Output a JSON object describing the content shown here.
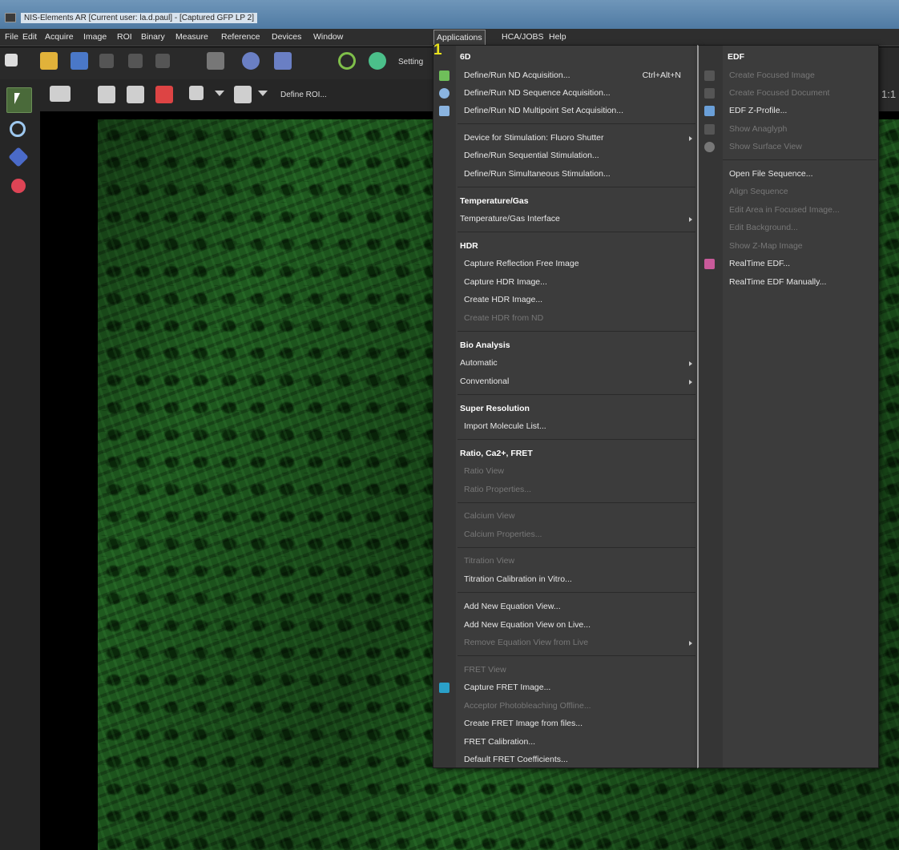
{
  "window": {
    "title": "NIS-Elements AR [Current user: la.d.paul] - [Captured GFP LP 2]"
  },
  "menubar": {
    "items": [
      "File",
      "Edit",
      "Acquire",
      "Image",
      "ROI",
      "Binary",
      "Measure",
      "Reference",
      "Devices",
      "Window",
      "Applications",
      "HCA/JOBS",
      "Help"
    ],
    "active": "Applications"
  },
  "toolbar": {
    "settings_label": "Setting",
    "define_roi_label": "Define ROI..."
  },
  "zoom_label": "1:1",
  "step_marker": "1",
  "applications_menu": {
    "sections": {
      "six_d": "6D",
      "temperature": "Temperature/Gas",
      "hdr": "HDR",
      "bio": "Bio Analysis",
      "super_res": "Super Resolution",
      "ratio": "Ratio, Ca2+, FRET"
    },
    "items": {
      "nd_acq": "Define/Run ND Acquisition...",
      "nd_acq_shortcut": "Ctrl+Alt+N",
      "nd_seq": "Define/Run ND Sequence Acquisition...",
      "nd_multi": "Define/Run ND Multipoint Set Acquisition...",
      "stim_device": "Device for Stimulation: Fluoro Shutter",
      "seq_stim": "Define/Run Sequential Stimulation...",
      "sim_stim": "Define/Run Simultaneous Stimulation...",
      "temp_iface": "Temperature/Gas Interface",
      "refl_free": "Capture Reflection Free Image",
      "cap_hdr": "Capture HDR Image...",
      "create_hdr": "Create HDR Image...",
      "hdr_from_nd": "Create HDR from ND",
      "automatic": "Automatic",
      "conventional": "Conventional",
      "import_mol": "Import Molecule List...",
      "ratio_view": "Ratio View",
      "ratio_props": "Ratio Properties...",
      "calcium_view": "Calcium View",
      "calcium_props": "Calcium Properties...",
      "titration_view": "Titration View",
      "titration_cal": "Titration Calibration in Vitro...",
      "add_eq": "Add New Equation View...",
      "add_eq_live": "Add New Equation View on Live...",
      "remove_eq_live": "Remove Equation View from Live",
      "fret_view": "FRET View",
      "cap_fret": "Capture FRET Image...",
      "acceptor": "Acceptor Photobleaching Offline...",
      "fret_files": "Create FRET Image from files...",
      "fret_cal": "FRET Calibration...",
      "fret_coeff": "Default FRET Coefficients..."
    }
  },
  "edf_submenu": {
    "header": "EDF",
    "items": {
      "focused_image": "Create Focused Image",
      "focused_doc": "Create Focused Document",
      "z_profile": "EDF Z-Profile...",
      "anaglyph": "Show Anaglyph",
      "surface": "Show Surface View",
      "open_seq": "Open File Sequence...",
      "align": "Align Sequence",
      "edit_area": "Edit Area in Focused Image...",
      "edit_bg": "Edit Background...",
      "zmap": "Show Z-Map Image",
      "realtime": "RealTime EDF...",
      "realtime_manual": "RealTime EDF Manually..."
    }
  },
  "colors": {
    "menu_bg": "#3c3c3c",
    "fluorescence": "#1f5a1f",
    "marker": "#e8e21c"
  }
}
